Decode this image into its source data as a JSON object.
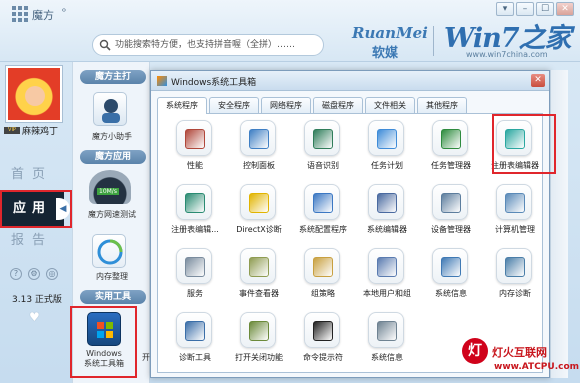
{
  "app": {
    "title": "魔方",
    "title_tail": "ᵒ",
    "window_controls": [
      "▾",
      "–",
      "☐",
      "✕"
    ]
  },
  "search": {
    "placeholder": "功能搜索特方便，也支持拼音喔（全拼）……"
  },
  "branding": {
    "ruanmei": "RuanMei",
    "ruanmei_cn": "软媒",
    "win7": "Win7之家",
    "win7_url": "www.win7china.com"
  },
  "user": {
    "name": "麻辣鸡丁",
    "vip": "VIP"
  },
  "nav": {
    "home": "首页",
    "app": "应用",
    "report": "报告"
  },
  "footer": {
    "icons": [
      "?",
      "⚙",
      "◎"
    ],
    "version": "3.13 正式版"
  },
  "middle": {
    "sections": [
      {
        "header": "魔方主打",
        "tool": "魔方小助手"
      },
      {
        "header": "魔方应用",
        "tool": "魔方网速测试",
        "tool_badge": "10M/s",
        "tool2": "内存整理"
      },
      {
        "header": "实用工具",
        "tool": "Windows\n系统工具箱"
      }
    ],
    "more": "开"
  },
  "dialog": {
    "title": "Windows系统工具箱",
    "close": "✕",
    "tabs": [
      "系统程序",
      "安全程序",
      "网络程序",
      "磁盘程序",
      "文件相关",
      "其他程序"
    ],
    "active_tab": 0,
    "tools": [
      {
        "label": "性能",
        "icon": "performance-icon",
        "color": "#b0473a"
      },
      {
        "label": "控制面板",
        "icon": "control-panel-icon",
        "color": "#3f7fc4"
      },
      {
        "label": "语音识别",
        "icon": "speech-recognition-icon",
        "color": "#2f7d5a"
      },
      {
        "label": "任务计划",
        "icon": "task-scheduler-icon",
        "color": "#3f8cd8"
      },
      {
        "label": "任务管理器",
        "icon": "task-manager-icon",
        "color": "#2e8b3e"
      },
      {
        "label": "注册表编辑器",
        "icon": "registry-editor-icon",
        "color": "#2aa7a0"
      },
      {
        "label": "注册表编辑...",
        "icon": "registry-editor-32-icon",
        "color": "#2a8b72"
      },
      {
        "label": "DirectX诊断",
        "icon": "directx-icon",
        "color": "#e1b400"
      },
      {
        "label": "系统配置程序",
        "icon": "msconfig-icon",
        "color": "#3c78c3"
      },
      {
        "label": "系统编辑器",
        "icon": "sysedit-icon",
        "color": "#4a6aa0"
      },
      {
        "label": "设备管理器",
        "icon": "device-manager-icon",
        "color": "#5c7d9d"
      },
      {
        "label": "计算机管理",
        "icon": "computer-management-icon",
        "color": "#5a8ab8"
      },
      {
        "label": "服务",
        "icon": "services-icon",
        "color": "#7a8c9e"
      },
      {
        "label": "事件查看器",
        "icon": "event-viewer-icon",
        "color": "#8f9c52"
      },
      {
        "label": "组策略",
        "icon": "group-policy-icon",
        "color": "#c8a040"
      },
      {
        "label": "本地用户和组",
        "icon": "local-users-icon",
        "color": "#5a7bb0"
      },
      {
        "label": "系统信息",
        "icon": "system-info-icon",
        "color": "#3f79b4"
      },
      {
        "label": "内存诊断",
        "icon": "memory-diagnostic-icon",
        "color": "#4a7ea8"
      },
      {
        "label": "诊断工具",
        "icon": "diagnostic-tool-icon",
        "color": "#3a6ea8"
      },
      {
        "label": "打开关闭功能",
        "icon": "windows-features-icon",
        "color": "#6b8a3a"
      },
      {
        "label": "命令提示符",
        "icon": "command-prompt-icon",
        "color": "#222222"
      },
      {
        "label": "系统信息",
        "icon": "system-info-2-icon",
        "color": "#6f8392"
      }
    ]
  },
  "watermark": {
    "badge": "灯",
    "text": "灯火互联网",
    "url": "www.ATCPU.com"
  },
  "colors": {
    "highlight": "#e0262c",
    "nav_active": "#152433",
    "accent": "#2f6fb0"
  }
}
